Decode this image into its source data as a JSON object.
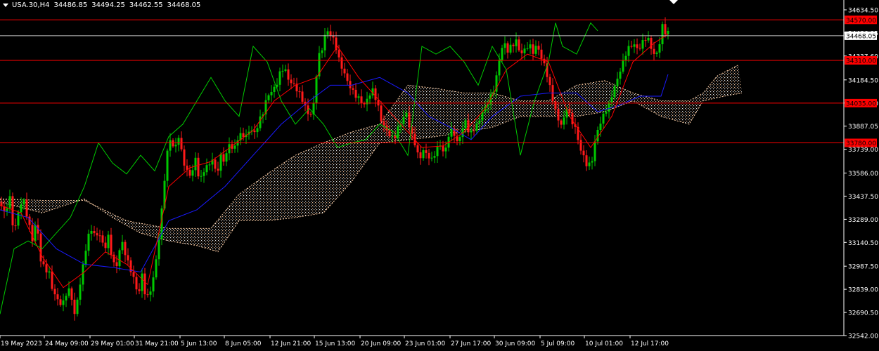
{
  "header": {
    "symbol": "USA.30,H4",
    "open": "34486.85",
    "high": "34494.25",
    "low": "34462.55",
    "close": "34468.05"
  },
  "colors": {
    "background": "#000000",
    "axis": "#ffffff",
    "bull_candle": "#00c800",
    "bear_candle": "#ff1a1a",
    "tenkan": "#ff0000",
    "kijun": "#1a1aff",
    "chikou": "#00cc00",
    "kumo_up": "#f5c7a0",
    "kumo_down": "#ffffff",
    "level_line": "#ff0000",
    "price_label_bg": "#ff0000"
  },
  "chart_data": {
    "type": "candlestick",
    "y_min": 32542.0,
    "y_max": 34634.5,
    "y_ticks": [
      "34634.50",
      "34486.05",
      "34337.60",
      "34184.50",
      "34035.60",
      "33887.05",
      "33739.00",
      "33586.00",
      "33437.50",
      "33289.00",
      "33140.50",
      "32987.50",
      "32839.00",
      "32690.50",
      "32542.00"
    ],
    "x_labels": [
      "19 May 2023",
      "24 May 09:00",
      "29 May 01:00",
      "31 May 21:00",
      "5 Jun 13:00",
      "8 Jun 05:00",
      "12 Jun 21:00",
      "15 Jun 13:00",
      "20 Jun 09:00",
      "23 Jun 01:00",
      "27 Jun 17:00",
      "30 Jun 09:00",
      "5 Jul 09:00",
      "10 Jul 01:00",
      "12 Jul 17:00"
    ],
    "levels": [
      {
        "price": 34570.0,
        "label": "34570.00"
      },
      {
        "price": 34310.0,
        "label": "34310.00"
      },
      {
        "price": 34035.0,
        "label": "34035.00"
      },
      {
        "price": 33780.0,
        "label": "33780.00"
      }
    ],
    "current_price": {
      "price": 34468.05,
      "label": "34468.05"
    },
    "close_path": [
      [
        0,
        33400
      ],
      [
        6,
        33350
      ],
      [
        14,
        33450
      ],
      [
        20,
        33200
      ],
      [
        25,
        33320
      ],
      [
        33,
        33400
      ],
      [
        40,
        33250
      ],
      [
        46,
        33150
      ],
      [
        52,
        33300
      ],
      [
        58,
        33050
      ],
      [
        64,
        33000
      ],
      [
        70,
        32950
      ],
      [
        76,
        32800
      ],
      [
        82,
        32750
      ],
      [
        88,
        32700
      ],
      [
        94,
        32800
      ],
      [
        100,
        32850
      ],
      [
        106,
        32700
      ],
      [
        112,
        32850
      ],
      [
        118,
        33000
      ],
      [
        124,
        33150
      ],
      [
        130,
        33200
      ],
      [
        136,
        33150
      ],
      [
        142,
        33180
      ],
      [
        148,
        33100
      ],
      [
        154,
        33200
      ],
      [
        160,
        33050
      ],
      [
        166,
        33000
      ],
      [
        172,
        33150
      ],
      [
        178,
        33050
      ],
      [
        184,
        32950
      ],
      [
        190,
        32900
      ],
      [
        196,
        32800
      ],
      [
        202,
        32950
      ],
      [
        208,
        32800
      ],
      [
        214,
        32850
      ],
      [
        220,
        32950
      ],
      [
        226,
        33150
      ],
      [
        232,
        33400
      ],
      [
        236,
        33650
      ],
      [
        242,
        33800
      ],
      [
        248,
        33750
      ],
      [
        254,
        33850
      ],
      [
        260,
        33700
      ],
      [
        266,
        33600
      ],
      [
        272,
        33550
      ],
      [
        278,
        33650
      ],
      [
        284,
        33500
      ],
      [
        290,
        33600
      ],
      [
        296,
        33650
      ],
      [
        302,
        33700
      ],
      [
        308,
        33600
      ],
      [
        314,
        33700
      ],
      [
        320,
        33650
      ],
      [
        326,
        33750
      ],
      [
        332,
        33700
      ],
      [
        338,
        33800
      ],
      [
        344,
        33850
      ],
      [
        350,
        33850
      ],
      [
        356,
        33900
      ],
      [
        362,
        33850
      ],
      [
        368,
        33900
      ],
      [
        374,
        33950
      ],
      [
        380,
        34050
      ],
      [
        386,
        34100
      ],
      [
        392,
        34150
      ],
      [
        398,
        34250
      ],
      [
        404,
        34300
      ],
      [
        410,
        34200
      ],
      [
        416,
        34150
      ],
      [
        422,
        34100
      ],
      [
        428,
        34050
      ],
      [
        434,
        34000
      ],
      [
        440,
        33950
      ],
      [
        446,
        34050
      ],
      [
        452,
        34350
      ],
      [
        458,
        34400
      ],
      [
        464,
        34500
      ],
      [
        470,
        34450
      ],
      [
        476,
        34400
      ],
      [
        482,
        34300
      ],
      [
        488,
        34250
      ],
      [
        494,
        34200
      ],
      [
        500,
        34150
      ],
      [
        506,
        34100
      ],
      [
        512,
        34050
      ],
      [
        518,
        34000
      ],
      [
        524,
        34050
      ],
      [
        530,
        34100
      ],
      [
        536,
        34050
      ],
      [
        542,
        33950
      ],
      [
        548,
        33900
      ],
      [
        554,
        33850
      ],
      [
        560,
        33800
      ],
      [
        566,
        33850
      ],
      [
        572,
        33900
      ],
      [
        578,
        33950
      ],
      [
        584,
        33850
      ],
      [
        590,
        33800
      ],
      [
        596,
        33700
      ],
      [
        602,
        33750
      ],
      [
        608,
        33700
      ],
      [
        614,
        33650
      ],
      [
        620,
        33700
      ],
      [
        626,
        33750
      ],
      [
        632,
        33700
      ],
      [
        638,
        33850
      ],
      [
        644,
        33900
      ],
      [
        650,
        33800
      ],
      [
        656,
        33850
      ],
      [
        662,
        33900
      ],
      [
        668,
        33800
      ],
      [
        674,
        33850
      ],
      [
        680,
        33900
      ],
      [
        686,
        34000
      ],
      [
        692,
        34050
      ],
      [
        698,
        34100
      ],
      [
        704,
        34150
      ],
      [
        710,
        34300
      ],
      [
        716,
        34400
      ],
      [
        722,
        34350
      ],
      [
        728,
        34400
      ],
      [
        734,
        34450
      ],
      [
        740,
        34380
      ],
      [
        746,
        34400
      ],
      [
        752,
        34420
      ],
      [
        758,
        34350
      ],
      [
        764,
        34380
      ],
      [
        770,
        34300
      ],
      [
        776,
        34250
      ],
      [
        782,
        34150
      ],
      [
        788,
        34050
      ],
      [
        794,
        33950
      ],
      [
        800,
        33900
      ],
      [
        806,
        34000
      ],
      [
        812,
        33900
      ],
      [
        818,
        33850
      ],
      [
        824,
        33750
      ],
      [
        830,
        33700
      ],
      [
        836,
        33650
      ],
      [
        842,
        33700
      ],
      [
        848,
        33850
      ],
      [
        854,
        33900
      ],
      [
        860,
        33950
      ],
      [
        866,
        34000
      ],
      [
        872,
        34100
      ],
      [
        878,
        34200
      ],
      [
        884,
        34300
      ],
      [
        890,
        34380
      ],
      [
        896,
        34420
      ],
      [
        902,
        34400
      ],
      [
        908,
        34350
      ],
      [
        914,
        34400
      ],
      [
        920,
        34450
      ],
      [
        926,
        34400
      ],
      [
        932,
        34350
      ],
      [
        938,
        34450
      ],
      [
        942,
        34550
      ],
      [
        946,
        34500
      ],
      [
        950,
        34480
      ]
    ],
    "tenkan_path": [
      [
        0,
        33380
      ],
      [
        30,
        33330
      ],
      [
        60,
        33050
      ],
      [
        90,
        32850
      ],
      [
        120,
        32950
      ],
      [
        150,
        33080
      ],
      [
        180,
        33000
      ],
      [
        210,
        32870
      ],
      [
        240,
        33500
      ],
      [
        270,
        33620
      ],
      [
        300,
        33660
      ],
      [
        330,
        33760
      ],
      [
        360,
        33860
      ],
      [
        390,
        34050
      ],
      [
        420,
        34150
      ],
      [
        450,
        34200
      ],
      [
        480,
        34400
      ],
      [
        510,
        34200
      ],
      [
        540,
        34050
      ],
      [
        570,
        33900
      ],
      [
        600,
        33750
      ],
      [
        630,
        33760
      ],
      [
        660,
        33850
      ],
      [
        690,
        34000
      ],
      [
        720,
        34250
      ],
      [
        750,
        34350
      ],
      [
        780,
        34300
      ],
      [
        810,
        33950
      ],
      [
        840,
        33750
      ],
      [
        870,
        33950
      ],
      [
        900,
        34300
      ],
      [
        930,
        34420
      ],
      [
        950,
        34480
      ]
    ],
    "kijun_path": [
      [
        0,
        33350
      ],
      [
        40,
        33300
      ],
      [
        80,
        33100
      ],
      [
        120,
        33000
      ],
      [
        160,
        32980
      ],
      [
        200,
        32950
      ],
      [
        240,
        33280
      ],
      [
        280,
        33350
      ],
      [
        320,
        33500
      ],
      [
        360,
        33700
      ],
      [
        400,
        33900
      ],
      [
        440,
        34050
      ],
      [
        470,
        34150
      ],
      [
        500,
        34150
      ],
      [
        540,
        34200
      ],
      [
        580,
        34100
      ],
      [
        610,
        33950
      ],
      [
        640,
        33880
      ],
      [
        670,
        33800
      ],
      [
        700,
        33950
      ],
      [
        740,
        34080
      ],
      [
        780,
        34100
      ],
      [
        820,
        34100
      ],
      [
        850,
        33980
      ],
      [
        880,
        34020
      ],
      [
        910,
        34080
      ],
      [
        940,
        34080
      ],
      [
        950,
        34220
      ]
    ],
    "chikou_path": [
      [
        0,
        32680
      ],
      [
        20,
        33100
      ],
      [
        40,
        33150
      ],
      [
        60,
        33100
      ],
      [
        80,
        33200
      ],
      [
        100,
        33300
      ],
      [
        120,
        33500
      ],
      [
        140,
        33780
      ],
      [
        160,
        33650
      ],
      [
        180,
        33580
      ],
      [
        200,
        33700
      ],
      [
        220,
        33600
      ],
      [
        240,
        33820
      ],
      [
        260,
        33900
      ],
      [
        280,
        34050
      ],
      [
        300,
        34200
      ],
      [
        320,
        34050
      ],
      [
        340,
        33950
      ],
      [
        360,
        34400
      ],
      [
        380,
        34300
      ],
      [
        400,
        34050
      ],
      [
        420,
        33900
      ],
      [
        440,
        34000
      ],
      [
        460,
        33900
      ],
      [
        480,
        33750
      ],
      [
        500,
        33780
      ],
      [
        520,
        33800
      ],
      [
        540,
        33900
      ],
      [
        560,
        33850
      ],
      [
        580,
        33700
      ],
      [
        600,
        34400
      ],
      [
        620,
        34350
      ],
      [
        640,
        34400
      ],
      [
        660,
        34300
      ],
      [
        680,
        34150
      ],
      [
        700,
        34400
      ],
      [
        720,
        34250
      ],
      [
        740,
        33700
      ],
      [
        760,
        34050
      ],
      [
        780,
        34300
      ],
      [
        790,
        34550
      ],
      [
        800,
        34400
      ],
      [
        820,
        34350
      ],
      [
        840,
        34550
      ],
      [
        850,
        34500
      ]
    ],
    "kumo_top": [
      [
        0,
        33420
      ],
      [
        60,
        33410
      ],
      [
        120,
        33410
      ],
      [
        180,
        33280
      ],
      [
        240,
        33230
      ],
      [
        300,
        33230
      ],
      [
        340,
        33450
      ],
      [
        380,
        33580
      ],
      [
        420,
        33700
      ],
      [
        460,
        33780
      ],
      [
        500,
        33850
      ],
      [
        540,
        33900
      ],
      [
        580,
        34150
      ],
      [
        620,
        34130
      ],
      [
        660,
        34100
      ],
      [
        700,
        34100
      ],
      [
        740,
        34050
      ],
      [
        780,
        34050
      ],
      [
        820,
        34150
      ],
      [
        860,
        34180
      ],
      [
        900,
        34100
      ],
      [
        940,
        34050
      ],
      [
        980,
        34050
      ],
      [
        1000,
        34100
      ],
      [
        1020,
        34210
      ],
      [
        1050,
        34280
      ]
    ],
    "kumo_bottom": [
      [
        0,
        33400
      ],
      [
        60,
        33330
      ],
      [
        120,
        33420
      ],
      [
        160,
        33300
      ],
      [
        200,
        33200
      ],
      [
        240,
        33150
      ],
      [
        280,
        33120
      ],
      [
        310,
        33080
      ],
      [
        340,
        33280
      ],
      [
        380,
        33280
      ],
      [
        420,
        33300
      ],
      [
        460,
        33330
      ],
      [
        500,
        33530
      ],
      [
        540,
        33780
      ],
      [
        580,
        33800
      ],
      [
        620,
        33820
      ],
      [
        660,
        33850
      ],
      [
        700,
        33880
      ],
      [
        740,
        33950
      ],
      [
        780,
        33950
      ],
      [
        820,
        33950
      ],
      [
        860,
        33980
      ],
      [
        900,
        34050
      ],
      [
        940,
        33950
      ],
      [
        980,
        33900
      ],
      [
        1000,
        34050
      ],
      [
        1030,
        34080
      ],
      [
        1055,
        34100
      ]
    ]
  }
}
